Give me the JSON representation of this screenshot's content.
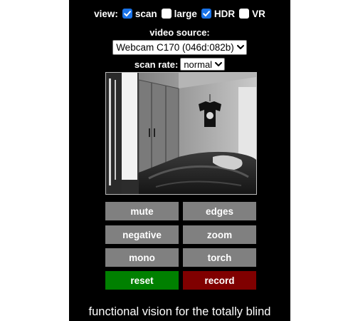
{
  "view": {
    "label": "view:",
    "options": [
      {
        "label": "scan",
        "checked": true
      },
      {
        "label": "large",
        "checked": false
      },
      {
        "label": "HDR",
        "checked": true
      },
      {
        "label": "VR",
        "checked": false
      }
    ]
  },
  "source": {
    "label": "video source:",
    "selected": "Webcam C170 (046d:082b)"
  },
  "scan_rate": {
    "label": "scan rate:",
    "selected": "normal"
  },
  "buttons": {
    "mute": "mute",
    "edges": "edges",
    "negative": "negative",
    "zoom": "zoom",
    "mono": "mono",
    "torch": "torch",
    "reset": "reset",
    "record": "record"
  },
  "colors": {
    "panel_bg": "#000000",
    "button_gray": "#808080",
    "reset_green": "#008000",
    "record_red": "#800000",
    "checkbox_accent": "#1a73e8"
  },
  "tagline": "functional vision for the totally blind"
}
